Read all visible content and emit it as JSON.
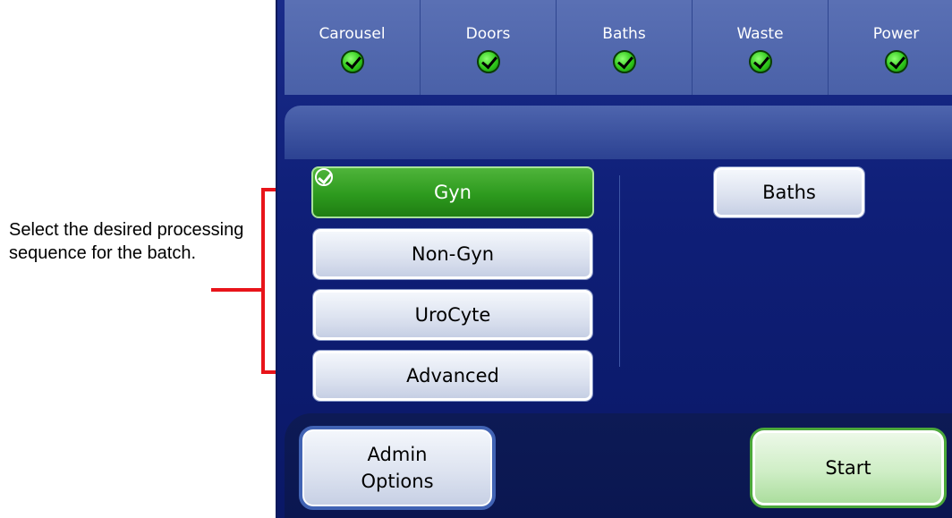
{
  "callout": {
    "text": "Select the desired processing sequence for the batch."
  },
  "status_bar": [
    {
      "label": "Carousel",
      "status": "ok"
    },
    {
      "label": "Doors",
      "status": "ok"
    },
    {
      "label": "Baths",
      "status": "ok"
    },
    {
      "label": "Waste",
      "status": "ok"
    },
    {
      "label": "Power",
      "status": "ok"
    }
  ],
  "sequences": {
    "gyn": "Gyn",
    "non_gyn": "Non-Gyn",
    "urocyte": "UroCyte",
    "advanced": "Advanced",
    "selected": "Gyn"
  },
  "baths_button": "Baths",
  "admin_button": {
    "line1": "Admin",
    "line2": "Options"
  },
  "start_button": "Start",
  "colors": {
    "screen_bg": "#0f1f78",
    "selected_green": "#2d9a1e",
    "callout_red": "#e8141a",
    "status_ok": "#2fc81a"
  },
  "icons": {
    "status": "checkmark-circle-icon",
    "selected": "checkmark-icon"
  }
}
